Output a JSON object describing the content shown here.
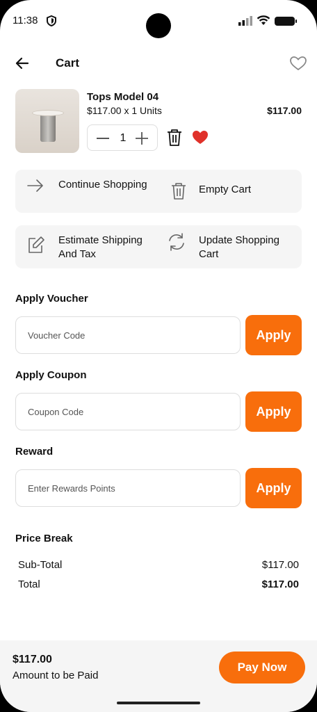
{
  "status": {
    "time": "11:38"
  },
  "header": {
    "title": "Cart"
  },
  "product": {
    "name": "Tops Model 04",
    "qty_line": "$117.00 x 1 Units",
    "price": "$117.00",
    "quantity": "1"
  },
  "actions": {
    "continue": "Continue Shopping",
    "empty": "Empty Cart",
    "estimate": "Estimate Shipping And Tax",
    "update": "Update Shopping Cart"
  },
  "voucher": {
    "title": "Apply Voucher",
    "placeholder": "Voucher Code",
    "button": "Apply"
  },
  "coupon": {
    "title": "Apply Coupon",
    "placeholder": "Coupon Code",
    "button": "Apply"
  },
  "reward": {
    "title": "Reward",
    "placeholder": "Enter Rewards Points",
    "button": "Apply"
  },
  "price_break": {
    "title": "Price Break",
    "rows": [
      {
        "label": "Sub-Total",
        "value": "$117.00"
      },
      {
        "label": "Total",
        "value": "$117.00"
      }
    ]
  },
  "footer": {
    "amount": "$117.00",
    "amount_label": "Amount to be Paid",
    "pay_button": "Pay Now"
  },
  "colors": {
    "accent": "#f86e0c",
    "heart": "#e0312a"
  },
  "icons": [
    "shield-icon",
    "signal-icon",
    "wifi-icon",
    "battery-icon",
    "back-arrow-icon",
    "heart-outline-icon",
    "minus-icon",
    "plus-icon",
    "trash-icon",
    "heart-filled-icon",
    "arrow-right-icon",
    "edit-icon",
    "refresh-icon"
  ]
}
